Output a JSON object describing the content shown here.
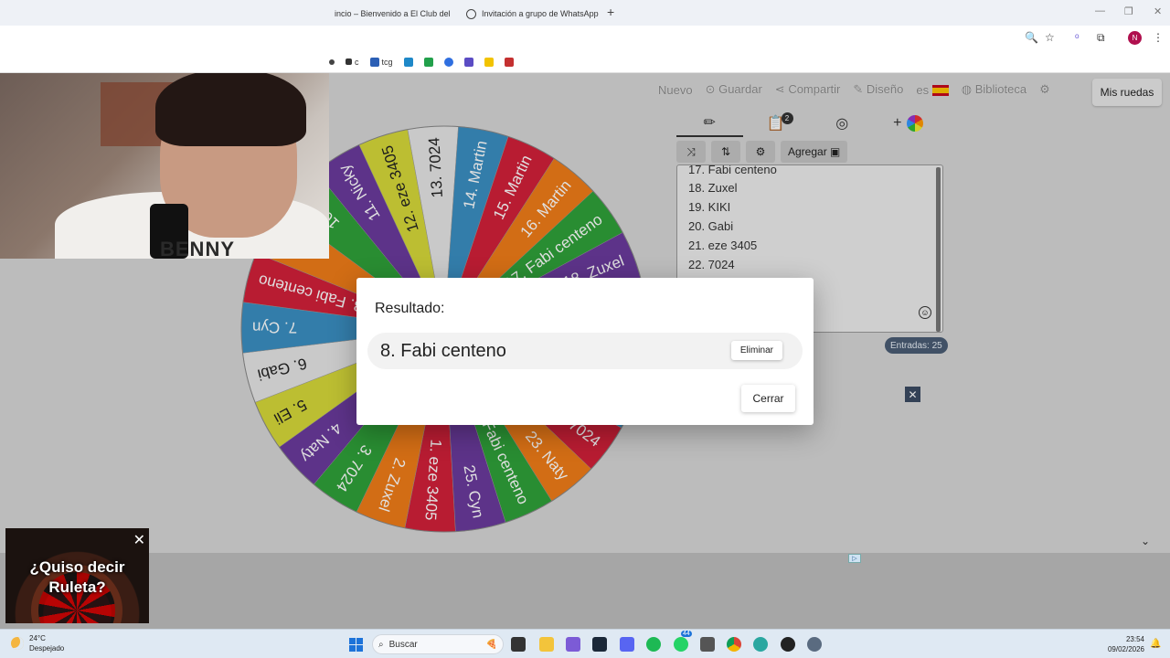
{
  "browser": {
    "tabs": [
      {
        "title": "incio – Bienvenido a El Club del"
      },
      {
        "title": "Invitación a grupo de WhatsApp"
      }
    ],
    "new_tab_label": "+",
    "profile_initial": "N",
    "bookmarks": [
      {
        "label": "c",
        "color": "#333333"
      },
      {
        "label": "tcg",
        "color": "#2b5fb5"
      },
      {
        "label": "",
        "color": "#1e88c8"
      },
      {
        "label": "",
        "color": "#22a04b"
      },
      {
        "label": "",
        "color": "#2f6fe0"
      },
      {
        "label": "",
        "color": "#5b4cc4"
      },
      {
        "label": "",
        "color": "#f2c300"
      },
      {
        "label": "",
        "color": "#c43030"
      }
    ]
  },
  "webcam": {
    "shirt_text": "BENNY"
  },
  "app": {
    "toolbar": {
      "new": "Nuevo",
      "save": "Guardar",
      "share": "Compartir",
      "design": "Diseño",
      "lang": "es",
      "library": "Biblioteca",
      "my_wheels": "Mis ruedas"
    },
    "panel_tabs": {
      "edit_icon": "pencil-icon",
      "results_badge": "2",
      "hide_icon": "eye-slash-icon",
      "add_icon": "plus-icon"
    },
    "tools": {
      "shuffle_icon": "shuffle-icon",
      "sort_icon": "sort-icon",
      "settings_icon": "gear-icon",
      "add_image": "Agregar"
    },
    "entries_visible": [
      "17. Fabi centeno",
      "18. Zuxel",
      "19. KIKI",
      "20. Gabi",
      "21. eze 3405",
      "22. 7024"
    ],
    "entries_count": "Entradas: 25",
    "ad_close": "✕"
  },
  "wheel": {
    "segments": [
      {
        "label": "1. eze 3405",
        "color": "#d2203a"
      },
      {
        "label": "2. Zuxel",
        "color": "#f07d19"
      },
      {
        "label": "3. 7024",
        "color": "#2fa13a"
      },
      {
        "label": "4. Naty",
        "color": "#6a3b9c"
      },
      {
        "label": "5. Eli",
        "color": "#d6d93a"
      },
      {
        "label": "6. Gabi",
        "color": "#e5e5e5"
      },
      {
        "label": "7. Cyn",
        "color": "#3b8fc2"
      },
      {
        "label": "8. Fabi centeno",
        "color": "#d2203a"
      },
      {
        "label": "9. Eli",
        "color": "#f07d19"
      },
      {
        "label": "10. Eli",
        "color": "#2fa13a"
      },
      {
        "label": "11. Nicky",
        "color": "#6a3b9c"
      },
      {
        "label": "12. eze 3405",
        "color": "#d6d93a"
      },
      {
        "label": "13. 7024",
        "color": "#e5e5e5"
      },
      {
        "label": "14. Martin",
        "color": "#3b8fc2"
      },
      {
        "label": "15. Martin",
        "color": "#d2203a"
      },
      {
        "label": "16. Martin",
        "color": "#f07d19"
      },
      {
        "label": "17. Fabi centeno",
        "color": "#2fa13a"
      },
      {
        "label": "18. Zuxel",
        "color": "#6a3b9c"
      },
      {
        "label": "19. KIKI",
        "color": "#d6d93a"
      },
      {
        "label": "20. Gabi",
        "color": "#e5e5e5"
      },
      {
        "label": "21. eze 3405",
        "color": "#3b8fc2"
      },
      {
        "label": "22. 7024",
        "color": "#d2203a"
      },
      {
        "label": "23. Naty",
        "color": "#f07d19"
      },
      {
        "label": "24. Fabi centeno",
        "color": "#2fa13a"
      },
      {
        "label": "25. Cyn",
        "color": "#6a3b9c"
      }
    ]
  },
  "modal": {
    "title": "Resultado:",
    "result": "8. Fabi centeno",
    "remove_label": "Eliminar",
    "close_label": "Cerrar"
  },
  "promo": {
    "text_line1": "¿Quiso decir",
    "text_line2": "Ruleta?",
    "close": "✕"
  },
  "taskbar": {
    "temperature": "24°C",
    "weather": "Despejado",
    "search_placeholder": "Buscar",
    "time": "23:54",
    "date": "09/02/2026",
    "whatsapp_badge": "44"
  }
}
